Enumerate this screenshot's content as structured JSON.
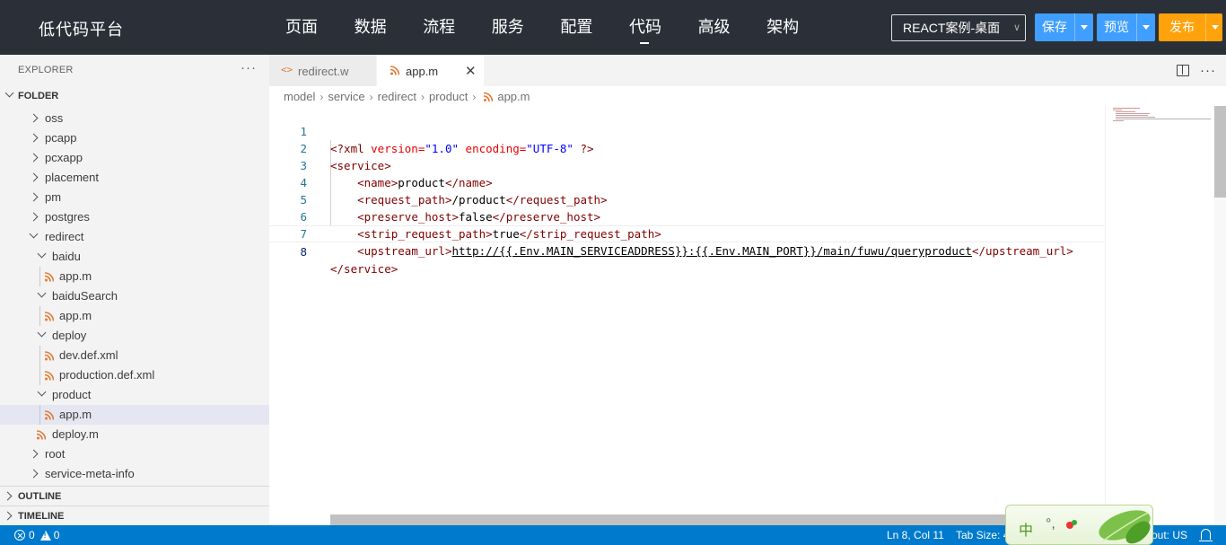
{
  "topbar": {
    "brand": "低代码平台",
    "nav": [
      "页面",
      "数据",
      "流程",
      "服务",
      "配置",
      "代码",
      "高级",
      "架构"
    ],
    "active_nav": "代码",
    "env_select": "REACT案例-桌面",
    "buttons": {
      "save": "保存",
      "preview": "预览",
      "publish": "发布"
    }
  },
  "colors": {
    "topbar_bg": "#2b3038",
    "button_blue": "#409eff",
    "button_orange": "#ffa20b",
    "status_bg": "#007acc"
  },
  "sidebar": {
    "title": "EXPLORER",
    "more": "···",
    "folder": "FOLDER",
    "tree": [
      {
        "label": "oss",
        "depth": 0,
        "kind": "folder-closed"
      },
      {
        "label": "pcapp",
        "depth": 0,
        "kind": "folder-closed"
      },
      {
        "label": "pcxapp",
        "depth": 0,
        "kind": "folder-closed"
      },
      {
        "label": "placement",
        "depth": 0,
        "kind": "folder-closed"
      },
      {
        "label": "pm",
        "depth": 0,
        "kind": "folder-closed"
      },
      {
        "label": "postgres",
        "depth": 0,
        "kind": "folder-closed"
      },
      {
        "label": "redirect",
        "depth": 0,
        "kind": "folder-open"
      },
      {
        "label": "baidu",
        "depth": 1,
        "kind": "folder-open"
      },
      {
        "label": "app.m",
        "depth": 2,
        "kind": "file"
      },
      {
        "label": "baiduSearch",
        "depth": 1,
        "kind": "folder-open"
      },
      {
        "label": "app.m",
        "depth": 2,
        "kind": "file"
      },
      {
        "label": "deploy",
        "depth": 1,
        "kind": "folder-open"
      },
      {
        "label": "dev.def.xml",
        "depth": 2,
        "kind": "file"
      },
      {
        "label": "production.def.xml",
        "depth": 2,
        "kind": "file"
      },
      {
        "label": "product",
        "depth": 1,
        "kind": "folder-open"
      },
      {
        "label": "app.m",
        "depth": 2,
        "kind": "file",
        "selected": true
      },
      {
        "label": "deploy.m",
        "depth": 1,
        "kind": "file"
      },
      {
        "label": "root",
        "depth": 0,
        "kind": "folder-closed"
      },
      {
        "label": "service-meta-info",
        "depth": 0,
        "kind": "folder-closed"
      }
    ],
    "outline": "OUTLINE",
    "timeline": "TIMELINE"
  },
  "editor": {
    "tabs": [
      {
        "label": "redirect.w",
        "active": false
      },
      {
        "label": "app.m",
        "active": true
      }
    ],
    "breadcrumb": [
      "model",
      "service",
      "redirect",
      "product",
      "app.m"
    ],
    "line_numbers": [
      "1",
      "2",
      "3",
      "4",
      "5",
      "6",
      "7",
      "8"
    ],
    "code": {
      "l1_decl_open": "<?xml ",
      "l1_attr1": "version=",
      "l1_val1": "\"1.0\"",
      "l1_attr2": " encoding=",
      "l1_val2": "\"UTF-8\"",
      "l1_decl_close": " ?>",
      "l2_open": "<service>",
      "l3_open": "<name>",
      "l3_text": "product",
      "l3_close": "</name>",
      "l4_open": "<request_path>",
      "l4_text": "/product",
      "l4_close": "</request_path>",
      "l5_open": "<preserve_host>",
      "l5_text": "false",
      "l5_close": "</preserve_host>",
      "l6_open": "<strip_request_path>",
      "l6_text": "true",
      "l6_close": "</strip_request_path>",
      "l7_open": "<upstream_url>",
      "l7_text": "http://{{.Env.MAIN_SERVICEADDRESS}}:{{.Env.MAIN_PORT}}/main/fuwu/queryproduct",
      "l7_close": "</upstream_url>",
      "l8_close": "</service>"
    }
  },
  "status": {
    "errors": "0",
    "warnings": "0",
    "position": "Ln 8, Col 11",
    "tab_size": "Tab Size: 4",
    "layout": "out: US"
  },
  "ime": {
    "mode": "中",
    "punct": "°,"
  }
}
